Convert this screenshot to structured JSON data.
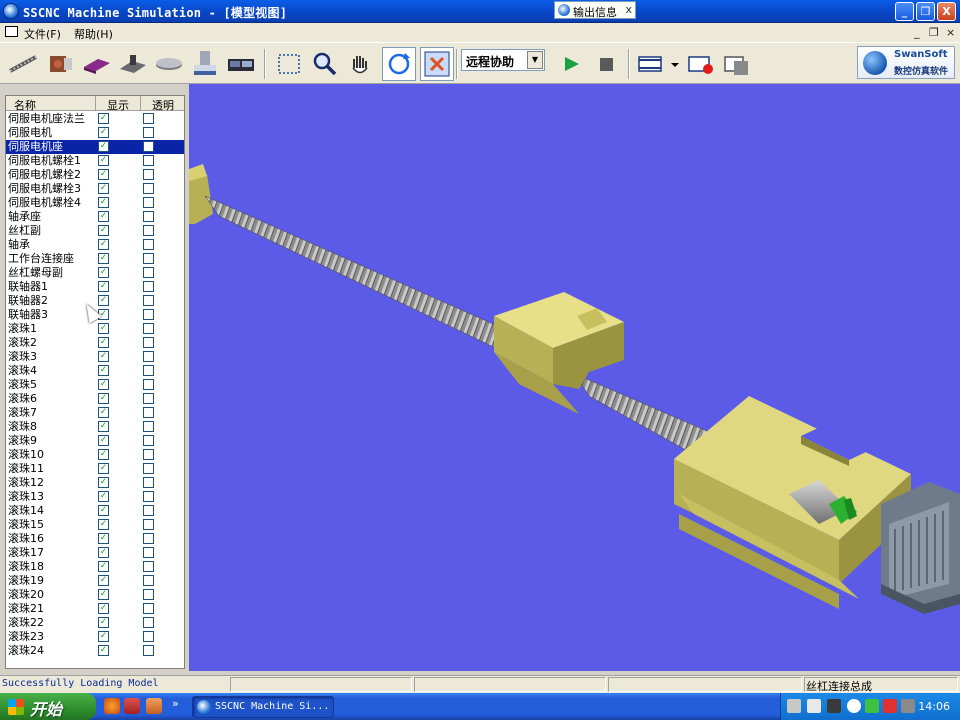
{
  "window": {
    "title": "SSCNC Machine Simulation - [模型视图]",
    "floating_tab": "输出信息",
    "floating_tab_close": "x",
    "min_label": "_",
    "max_label": "❐",
    "close_label": "X"
  },
  "menu": {
    "items": [
      "文件(F)",
      "帮助(H)"
    ],
    "mdi_min": "_",
    "mdi_restore": "❐",
    "mdi_close": "×"
  },
  "toolbar": {
    "mode_combo": "远程协助",
    "brand_name": "SwanSoft",
    "brand_sub": "数控仿真软件",
    "accent": "#0a24a8"
  },
  "tree": {
    "headers": [
      "名称",
      "显示",
      "透明"
    ],
    "selected_index": 2,
    "rows": [
      {
        "name": "伺服电机座法兰",
        "show": true,
        "transparent": false
      },
      {
        "name": "伺服电机",
        "show": true,
        "transparent": false
      },
      {
        "name": "伺服电机座",
        "show": true,
        "transparent": false
      },
      {
        "name": "伺服电机螺栓1",
        "show": true,
        "transparent": false
      },
      {
        "name": "伺服电机螺栓2",
        "show": true,
        "transparent": false
      },
      {
        "name": "伺服电机螺栓3",
        "show": true,
        "transparent": false
      },
      {
        "name": "伺服电机螺栓4",
        "show": true,
        "transparent": false
      },
      {
        "name": "轴承座",
        "show": true,
        "transparent": false
      },
      {
        "name": "丝杠副",
        "show": true,
        "transparent": false
      },
      {
        "name": "轴承",
        "show": true,
        "transparent": false
      },
      {
        "name": "工作台连接座",
        "show": true,
        "transparent": false
      },
      {
        "name": "丝杠螺母副",
        "show": true,
        "transparent": false
      },
      {
        "name": "联轴器1",
        "show": true,
        "transparent": false
      },
      {
        "name": "联轴器2",
        "show": true,
        "transparent": false
      },
      {
        "name": "联轴器3",
        "show": true,
        "transparent": false
      },
      {
        "name": "滚珠1",
        "show": true,
        "transparent": false
      },
      {
        "name": "滚珠2",
        "show": true,
        "transparent": false
      },
      {
        "name": "滚珠3",
        "show": true,
        "transparent": false
      },
      {
        "name": "滚珠4",
        "show": true,
        "transparent": false
      },
      {
        "name": "滚珠5",
        "show": true,
        "transparent": false
      },
      {
        "name": "滚珠6",
        "show": true,
        "transparent": false
      },
      {
        "name": "滚珠7",
        "show": true,
        "transparent": false
      },
      {
        "name": "滚珠8",
        "show": true,
        "transparent": false
      },
      {
        "name": "滚珠9",
        "show": true,
        "transparent": false
      },
      {
        "name": "滚珠10",
        "show": true,
        "transparent": false
      },
      {
        "name": "滚珠11",
        "show": true,
        "transparent": false
      },
      {
        "name": "滚珠12",
        "show": true,
        "transparent": false
      },
      {
        "name": "滚珠13",
        "show": true,
        "transparent": false
      },
      {
        "name": "滚珠14",
        "show": true,
        "transparent": false
      },
      {
        "name": "滚珠15",
        "show": true,
        "transparent": false
      },
      {
        "name": "滚珠16",
        "show": true,
        "transparent": false
      },
      {
        "name": "滚珠17",
        "show": true,
        "transparent": false
      },
      {
        "name": "滚珠18",
        "show": true,
        "transparent": false
      },
      {
        "name": "滚珠19",
        "show": true,
        "transparent": false
      },
      {
        "name": "滚珠20",
        "show": true,
        "transparent": false
      },
      {
        "name": "滚珠21",
        "show": true,
        "transparent": false
      },
      {
        "name": "滚珠22",
        "show": true,
        "transparent": false
      },
      {
        "name": "滚珠23",
        "show": true,
        "transparent": false
      },
      {
        "name": "滚珠24",
        "show": true,
        "transparent": false
      }
    ]
  },
  "viewport": {
    "background": "#5b5be8",
    "part_color": "#d8d070"
  },
  "status": {
    "left_text": "Successfully Loading Model",
    "right_text": "丝杠连接总成"
  },
  "taskbar": {
    "start_label": "开始",
    "task_label": "SSCNC Machine Si...",
    "clock": "14:06",
    "chevron": "»"
  }
}
